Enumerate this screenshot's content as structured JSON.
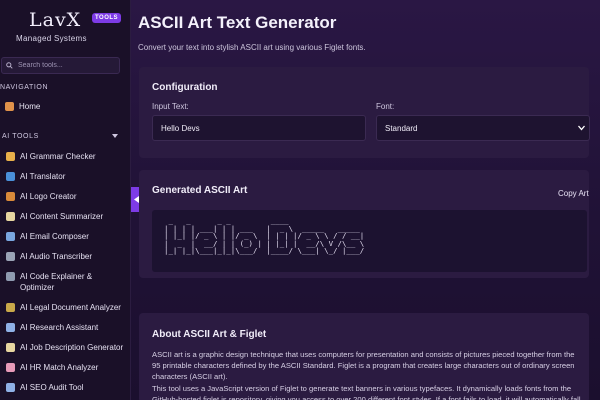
{
  "sidebar": {
    "logo": {
      "main": "LavX",
      "badge": "TOOLS",
      "sub": "Managed Systems"
    },
    "search_placeholder": "Search tools...",
    "nav_title": "NAVIGATION",
    "home_label": "Home",
    "ai_tools_title": "AI TOOLS",
    "tools": [
      {
        "label": "AI Grammar Checker",
        "icon": "pencil-icon",
        "color": "#e8b04a"
      },
      {
        "label": "AI Translator",
        "icon": "globe-icon",
        "color": "#4a90d9"
      },
      {
        "label": "AI Logo Creator",
        "icon": "palette-icon",
        "color": "#d98a3a"
      },
      {
        "label": "AI Content Summarizer",
        "icon": "memo-icon",
        "color": "#e7d6a0"
      },
      {
        "label": "AI Email Composer",
        "icon": "email-icon",
        "color": "#7aa7e0"
      },
      {
        "label": "AI Audio Transcriber",
        "icon": "microphone-icon",
        "color": "#9aa3b5"
      },
      {
        "label": "AI Code Explainer & Optimizer",
        "icon": "laptop-icon",
        "color": "#8f9bb0"
      },
      {
        "label": "AI Legal Document Analyzer",
        "icon": "scales-icon",
        "color": "#c9a94a"
      },
      {
        "label": "AI Research Assistant",
        "icon": "magnifier-icon",
        "color": "#8fb1e6"
      },
      {
        "label": "AI Job Description Generator",
        "icon": "memo-icon",
        "color": "#e7d6a0"
      },
      {
        "label": "AI HR Match Analyzer",
        "icon": "brain-icon",
        "color": "#e79ab8"
      },
      {
        "label": "AI SEO Audit Tool",
        "icon": "magnifier-icon",
        "color": "#8fb1e6"
      }
    ]
  },
  "main": {
    "title": "ASCII Art Text Generator",
    "subtitle": "Convert your text into stylish ASCII art using various Figlet fonts.",
    "config": {
      "heading": "Configuration",
      "input_label": "Input Text:",
      "input_value": "Hello Devs",
      "font_label": "Font:",
      "font_value": "Standard"
    },
    "output": {
      "heading": "Generated ASCII Art",
      "copy_label": "Copy Art",
      "ascii": " _   _      _ _         ____\n| | | | ___| | | ___   |  _ \\  _____   _____\n| |_| |/ _ \\ | |/ _ \\  | | | |/ _ \\ \\ / / __|\n|  _  |  __/ | | (_) | | |_| |  __/\\ V /\\__ \\\n|_| |_|\\___|_|_|\\___/  |____/ \\___| \\_/ |___/"
    },
    "about": {
      "heading": "About ASCII Art & Figlet",
      "p1": "ASCII art is a graphic design technique that uses computers for presentation and consists of pictures pieced together from the 95 printable characters defined by the ASCII Standard. Figlet is a program that creates large characters out of ordinary screen characters (ASCII art).",
      "p2": "This tool uses a JavaScript version of Figlet to generate text banners in various typefaces. It dynamically loads fonts from the GitHub-hosted figlet.js repository, giving you access to over 200 different font styles. If a font fails to load, it will automatically fall"
    }
  },
  "colors": {
    "accent": "#7d3be6",
    "background": "#201236",
    "card": "#2b1b41"
  }
}
